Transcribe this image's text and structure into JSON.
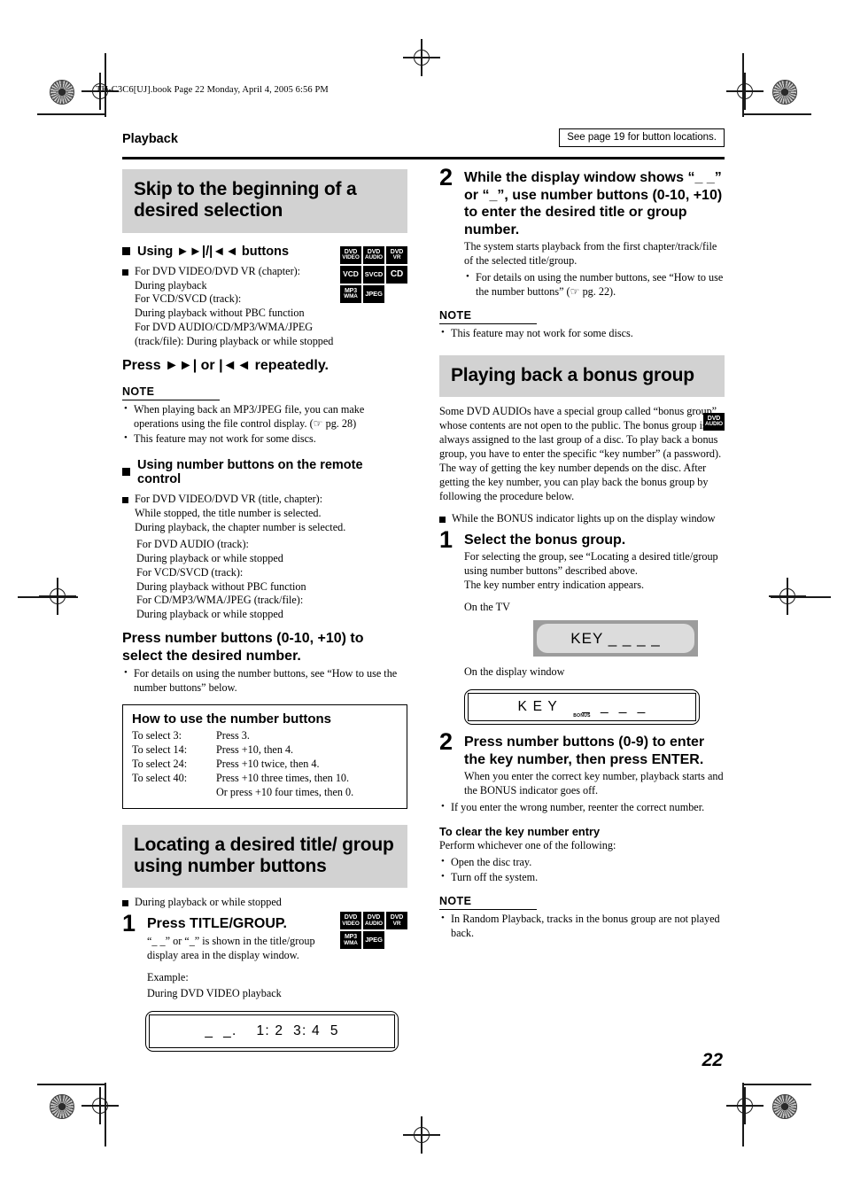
{
  "file_header": "TH-C3C6[UJ].book  Page 22  Monday, April 4, 2005  6:56 PM",
  "running_head": "Playback",
  "see_page_note": "See page 19 for button locations.",
  "page_number": "22",
  "colors": {
    "banner_bg": "#d2d2d2",
    "badge_bg": "#000000",
    "tv_bezel": "#9c9c9c",
    "tv_screen": "#dcdcdc"
  },
  "left": {
    "banner": "Skip to the beginning of a desired selection",
    "subhead_1": "Using ►►|/|◄◄ buttons",
    "badges_1": [
      {
        "l1": "DVD",
        "l2": "VIDEO"
      },
      {
        "l1": "DVD",
        "l2": "AUDIO"
      },
      {
        "l1": "DVD",
        "l2": "VR"
      },
      {
        "l1": "VCD",
        "l2": ""
      },
      {
        "l1": "SVCD",
        "l2": ""
      },
      {
        "l1": "CD",
        "l2": ""
      },
      {
        "l1": "MP3",
        "l2": "WMA"
      },
      {
        "l1": "JPEG",
        "l2": ""
      }
    ],
    "block_1": "For DVD VIDEO/DVD VR (chapter):\nDuring playback\nFor VCD/SVCD (track):\nDuring playback without PBC function\nFor DVD AUDIO/CD/MP3/WMA/JPEG (track/file): During playback or while stopped",
    "press_1": "Press ►►| or |◄◄ repeatedly.",
    "note_label_1": "NOTE",
    "notes_1": [
      "When playing back an MP3/JPEG file, you can make operations using the file control display. (☞ pg. 28)",
      "This feature may not work for some discs."
    ],
    "subhead_2": "Using number buttons on the remote control",
    "block_2a": "For DVD VIDEO/DVD VR (title, chapter):\nWhile stopped, the title number is selected.\nDuring playback, the chapter number is selected.",
    "block_2b": "For DVD AUDIO (track):\nDuring playback or while stopped\nFor VCD/SVCD (track):\nDuring playback without PBC function\nFor CD/MP3/WMA/JPEG (track/file):\nDuring playback or while stopped",
    "press_2": "Press number buttons (0-10, +10) to select the desired number.",
    "press_2_note": "For details on using the number buttons, see “How to use the number buttons” below.",
    "howbox": {
      "title": "How to use the number buttons",
      "rows": [
        {
          "label": "To select 3:",
          "action": "Press 3."
        },
        {
          "label": "To select 14:",
          "action": "Press +10, then 4."
        },
        {
          "label": "To select 24:",
          "action": "Press +10 twice, then 4."
        },
        {
          "label": "To select 40:",
          "action": "Press +10 three times, then 10."
        },
        {
          "label": "",
          "action": "Or press +10 four times, then 0."
        }
      ]
    },
    "banner_2": "Locating a desired title/ group using number buttons",
    "cond_2": "During playback or while stopped",
    "badges_2": [
      {
        "l1": "DVD",
        "l2": "VIDEO"
      },
      {
        "l1": "DVD",
        "l2": "AUDIO"
      },
      {
        "l1": "DVD",
        "l2": "VR"
      },
      {
        "l1": "MP3",
        "l2": "WMA"
      },
      {
        "l1": "JPEG",
        "l2": ""
      }
    ],
    "step_1_num": "1",
    "step_1_title": "Press TITLE/GROUP.",
    "step_1_body": "“_ _” or “_” is shown in the title/group display area in the display window.",
    "example_label": "Example:",
    "example_text": "During DVD VIDEO playback",
    "display_text": "_  _.    1: 2  3: 4  5"
  },
  "right": {
    "step_2_num": "2",
    "step_2_title": "While the display window shows “_ _” or “_”, use number buttons (0-10, +10) to enter the desired title or group number.",
    "step_2_body": "The system starts playback from the first chapter/track/file of the selected title/group.",
    "step_2_note": "For details on using the number buttons, see “How to use the number buttons” (☞ pg. 22).",
    "note_label_1": "NOTE",
    "notes_1": [
      "This feature may not work for some discs."
    ],
    "banner": "Playing back a bonus group",
    "badge": {
      "l1": "DVD",
      "l2": "AUDIO"
    },
    "intro": "Some DVD AUDIOs have a special group called “bonus group” whose contents are not open to the public. The bonus group is always assigned to the last group of a disc. To play back a bonus group, you have to enter the specific “key number” (a password). The way of getting the key number depends on the disc. After getting the key number, you can play back the bonus group by following the procedure below.",
    "cond": "While the BONUS indicator lights up on the display window",
    "step_b1_num": "1",
    "step_b1_title": "Select the bonus group.",
    "step_b1_body": "For selecting the group, see “Locating a desired title/group using number buttons” described above.\nThe key number entry indication appears.",
    "on_tv_label": "On the TV",
    "tv_text": "KEY _ _ _ _",
    "on_display_label": "On the display window",
    "display_text": "K E Y     _  _  _  _",
    "display_indicator": "BONUS",
    "step_b2_num": "2",
    "step_b2_title": "Press number buttons (0-9) to enter the key number, then press ENTER.",
    "step_b2_body": "When you enter the correct key number, playback starts and the BONUS indicator goes off.",
    "step_b2_note": "If you enter the wrong number, reenter the correct number.",
    "clear_head": "To clear the key number entry",
    "clear_intro": "Perform whichever one of the following:",
    "clear_items": [
      "Open the disc tray.",
      "Turn off the system."
    ],
    "note_label_2": "NOTE",
    "notes_2": [
      "In Random Playback, tracks in the bonus group are not played back."
    ]
  }
}
